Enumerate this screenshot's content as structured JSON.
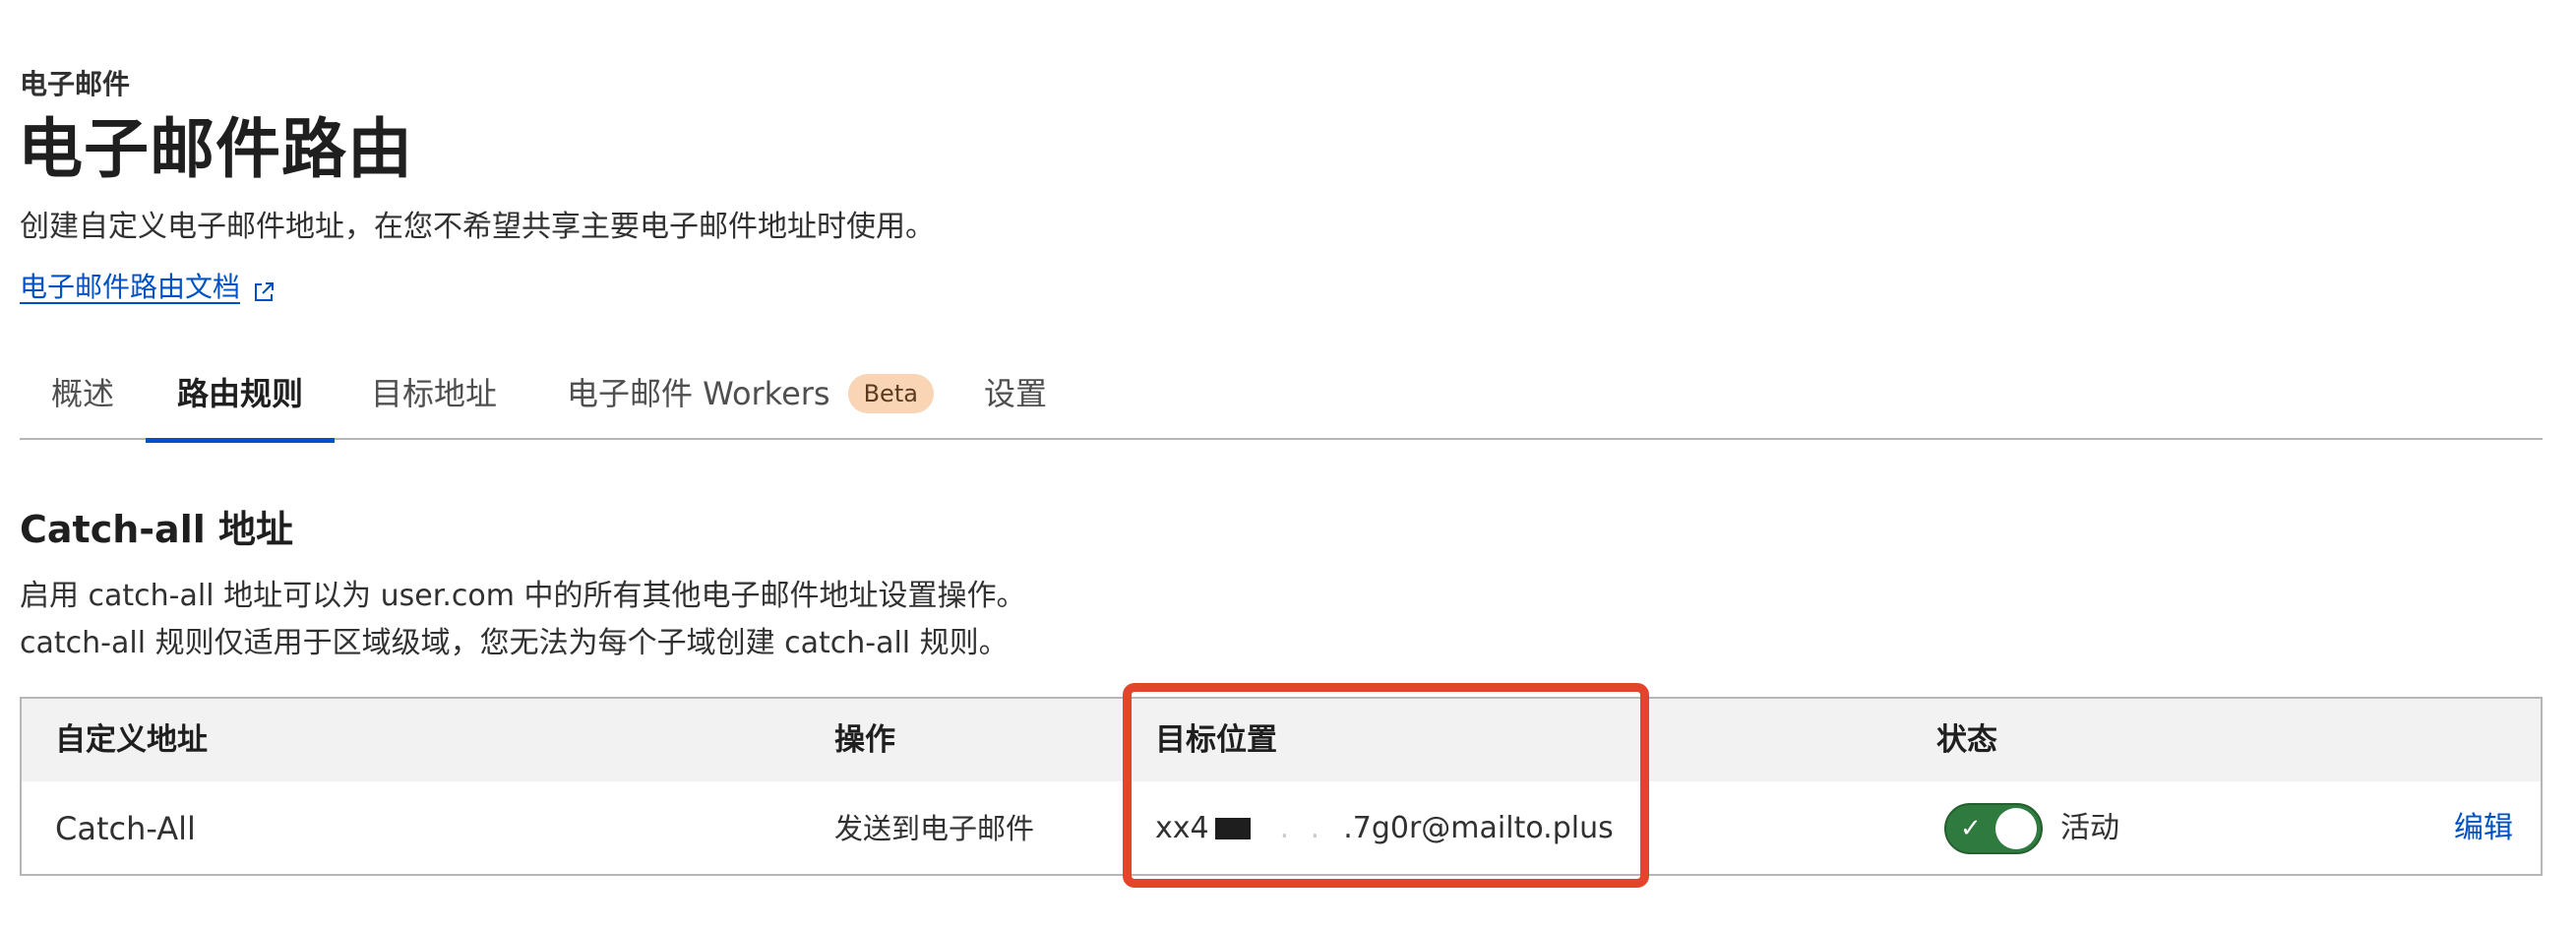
{
  "header": {
    "eyebrow": "电子邮件",
    "title": "电子邮件路由",
    "description": "创建自定义电子邮件地址，在您不希望共享主要电子邮件地址时使用。",
    "doc_link": "电子邮件路由文档",
    "doc_link_icon": "external-link-icon"
  },
  "tabs": [
    {
      "label": "概述",
      "active": false
    },
    {
      "label": "路由规则",
      "active": true
    },
    {
      "label": "目标地址",
      "active": false
    },
    {
      "label": "电子邮件 Workers",
      "badge": "Beta",
      "active": false
    },
    {
      "label": "设置",
      "active": false
    }
  ],
  "catch_all": {
    "title": "Catch-all 地址",
    "description_line1": "启用 catch-all 地址可以为 user.com 中的所有其他电子邮件地址设置操作。",
    "description_line2": "catch-all 规则仅适用于区域级域，您无法为每个子域创建 catch-all 规则。"
  },
  "table": {
    "columns": [
      "自定义地址",
      "操作",
      "目标位置",
      "状态"
    ],
    "rows": [
      {
        "name": "Catch-All",
        "action": "发送到电子邮件",
        "destination_prefix": "xx4",
        "destination_suffix": ".7g0r@mailto.plus",
        "status": "活动",
        "status_enabled": true,
        "edit": "编辑"
      }
    ]
  },
  "colors": {
    "link": "#0051c3",
    "toggle_on": "#2f7a3e",
    "highlight": "#e4442c",
    "badge_bg": "#f9d4b5"
  }
}
